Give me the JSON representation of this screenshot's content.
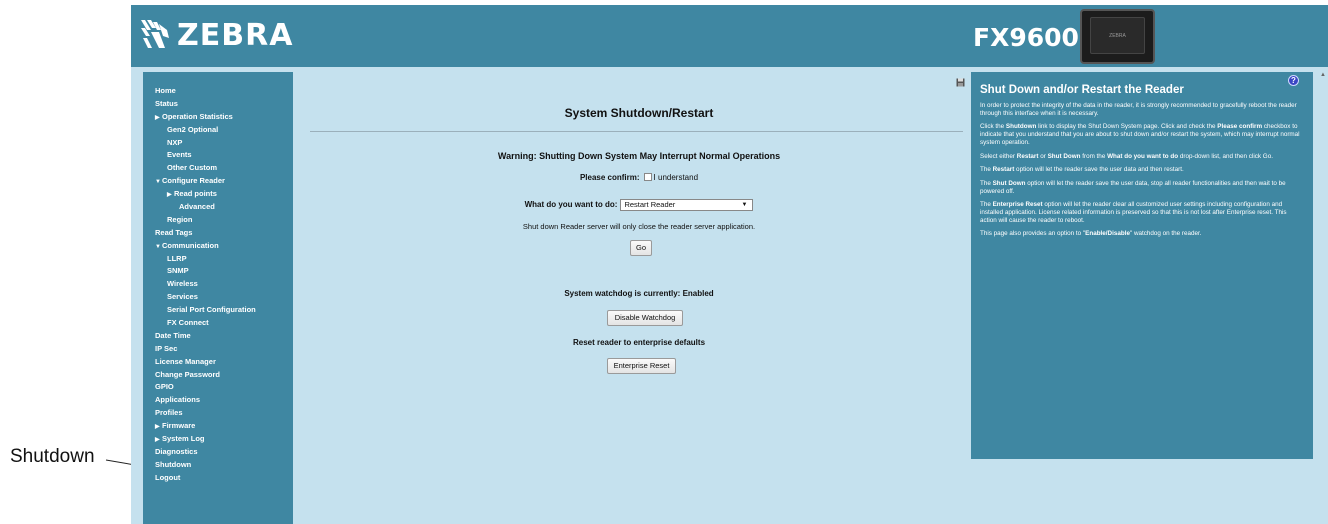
{
  "annotation": {
    "label": "Shutdown"
  },
  "header": {
    "brand": "ZEBRA",
    "model": "FX9600",
    "device_label": "ZEBRA"
  },
  "sidebar": {
    "items": [
      {
        "label": "Home",
        "level": 0
      },
      {
        "label": "Status",
        "level": 0
      },
      {
        "label": "Operation Statistics",
        "level": 0,
        "arrow": "right"
      },
      {
        "label": "Gen2 Optional",
        "level": 1
      },
      {
        "label": "NXP",
        "level": 1
      },
      {
        "label": "Events",
        "level": 1
      },
      {
        "label": "Other Custom",
        "level": 1
      },
      {
        "label": "Configure Reader",
        "level": 0,
        "arrow": "down"
      },
      {
        "label": "Read points",
        "level": 1,
        "arrow": "right"
      },
      {
        "label": "Advanced",
        "level": 2
      },
      {
        "label": "Region",
        "level": 1
      },
      {
        "label": "Read Tags",
        "level": 0
      },
      {
        "label": "Communication",
        "level": 0,
        "arrow": "down"
      },
      {
        "label": "LLRP",
        "level": 1
      },
      {
        "label": "SNMP",
        "level": 1
      },
      {
        "label": "Wireless",
        "level": 1
      },
      {
        "label": "Services",
        "level": 1
      },
      {
        "label": "Serial Port Configuration",
        "level": 1
      },
      {
        "label": "FX Connect",
        "level": 1
      },
      {
        "label": "Date Time",
        "level": 0
      },
      {
        "label": "IP Sec",
        "level": 0
      },
      {
        "label": "License Manager",
        "level": 0
      },
      {
        "label": "Change Password",
        "level": 0
      },
      {
        "label": "GPIO",
        "level": 0
      },
      {
        "label": "Applications",
        "level": 0
      },
      {
        "label": "Profiles",
        "level": 0
      },
      {
        "label": "Firmware",
        "level": 0,
        "arrow": "right"
      },
      {
        "label": "System Log",
        "level": 0,
        "arrow": "right"
      },
      {
        "label": "Diagnostics",
        "level": 0
      },
      {
        "label": "Shutdown",
        "level": 0
      },
      {
        "label": "Logout",
        "level": 0
      }
    ]
  },
  "main": {
    "title": "System Shutdown/Restart",
    "warning": "Warning: Shutting Down System May Interrupt Normal Operations",
    "confirm_label": "Please confirm:",
    "confirm_checkbox_label": "I understand",
    "action_label": "What do you want to do:",
    "action_selected": "Restart Reader",
    "shutdown_note": "Shut down Reader server will only close the reader server application.",
    "go_button": "Go",
    "watchdog_status": "System watchdog is currently: Enabled",
    "disable_watchdog_button": "Disable Watchdog",
    "reset_heading": "Reset reader to enterprise defaults",
    "enterprise_reset_button": "Enterprise Reset"
  },
  "help": {
    "title": "Shut Down and/or Restart the Reader",
    "p1": "In order to protect the integrity of the data in the reader, it is strongly recommended to gracefully reboot the reader through this interface when it is necessary.",
    "p2_a": "Click the ",
    "p2_b": "Shutdown",
    "p2_c": " link to display the Shut Down System page. Click and check the ",
    "p2_d": "Please confirm",
    "p2_e": " checkbox to indicate that you understand that you are about to shut down and/or restart the system, which may interrupt normal system operation.",
    "p3_a": "Select either ",
    "p3_b": "Restart",
    "p3_c": " or ",
    "p3_d": "Shut Down",
    "p3_e": " from the ",
    "p3_f": "What do you want to do",
    "p3_g": " drop-down list, and then click Go.",
    "p4_a": "The ",
    "p4_b": "Restart",
    "p4_c": " option will let the reader save the user data and then restart.",
    "p5_a": "The ",
    "p5_b": "Shut Down",
    "p5_c": " option will let the reader save the user data, stop all reader functionalities and then wait to be powered off.",
    "p6_a": "The ",
    "p6_b": "Enterprise Reset",
    "p6_c": " option will let the reader clear all customized user settings including configuration and installed application. License related information is preserved so that this is not lost after Enterprise reset. This action will cause the reader to reboot.",
    "p7_a": "This page also provides an option to \"",
    "p7_b": "Enable/Disable",
    "p7_c": "\" watchdog on the reader."
  },
  "colors": {
    "header": "#3f87a2",
    "sidebar": "#3f87a2",
    "content_bg": "#c5e1ee",
    "help_bg": "#3f87a2"
  },
  "icons": {
    "save": "save-icon",
    "help": "help-icon"
  }
}
